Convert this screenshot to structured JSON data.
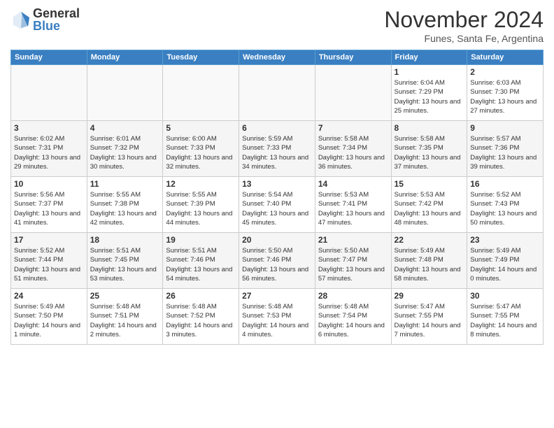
{
  "header": {
    "logo": {
      "general": "General",
      "blue": "Blue"
    },
    "title": "November 2024",
    "location": "Funes, Santa Fe, Argentina"
  },
  "days_of_week": [
    "Sunday",
    "Monday",
    "Tuesday",
    "Wednesday",
    "Thursday",
    "Friday",
    "Saturday"
  ],
  "weeks": [
    [
      {
        "day": "",
        "empty": true
      },
      {
        "day": "",
        "empty": true
      },
      {
        "day": "",
        "empty": true
      },
      {
        "day": "",
        "empty": true
      },
      {
        "day": "",
        "empty": true
      },
      {
        "day": "1",
        "sunrise": "Sunrise: 6:04 AM",
        "sunset": "Sunset: 7:29 PM",
        "daylight": "Daylight: 13 hours and 25 minutes."
      },
      {
        "day": "2",
        "sunrise": "Sunrise: 6:03 AM",
        "sunset": "Sunset: 7:30 PM",
        "daylight": "Daylight: 13 hours and 27 minutes."
      }
    ],
    [
      {
        "day": "3",
        "sunrise": "Sunrise: 6:02 AM",
        "sunset": "Sunset: 7:31 PM",
        "daylight": "Daylight: 13 hours and 29 minutes."
      },
      {
        "day": "4",
        "sunrise": "Sunrise: 6:01 AM",
        "sunset": "Sunset: 7:32 PM",
        "daylight": "Daylight: 13 hours and 30 minutes."
      },
      {
        "day": "5",
        "sunrise": "Sunrise: 6:00 AM",
        "sunset": "Sunset: 7:33 PM",
        "daylight": "Daylight: 13 hours and 32 minutes."
      },
      {
        "day": "6",
        "sunrise": "Sunrise: 5:59 AM",
        "sunset": "Sunset: 7:33 PM",
        "daylight": "Daylight: 13 hours and 34 minutes."
      },
      {
        "day": "7",
        "sunrise": "Sunrise: 5:58 AM",
        "sunset": "Sunset: 7:34 PM",
        "daylight": "Daylight: 13 hours and 36 minutes."
      },
      {
        "day": "8",
        "sunrise": "Sunrise: 5:58 AM",
        "sunset": "Sunset: 7:35 PM",
        "daylight": "Daylight: 13 hours and 37 minutes."
      },
      {
        "day": "9",
        "sunrise": "Sunrise: 5:57 AM",
        "sunset": "Sunset: 7:36 PM",
        "daylight": "Daylight: 13 hours and 39 minutes."
      }
    ],
    [
      {
        "day": "10",
        "sunrise": "Sunrise: 5:56 AM",
        "sunset": "Sunset: 7:37 PM",
        "daylight": "Daylight: 13 hours and 41 minutes."
      },
      {
        "day": "11",
        "sunrise": "Sunrise: 5:55 AM",
        "sunset": "Sunset: 7:38 PM",
        "daylight": "Daylight: 13 hours and 42 minutes."
      },
      {
        "day": "12",
        "sunrise": "Sunrise: 5:55 AM",
        "sunset": "Sunset: 7:39 PM",
        "daylight": "Daylight: 13 hours and 44 minutes."
      },
      {
        "day": "13",
        "sunrise": "Sunrise: 5:54 AM",
        "sunset": "Sunset: 7:40 PM",
        "daylight": "Daylight: 13 hours and 45 minutes."
      },
      {
        "day": "14",
        "sunrise": "Sunrise: 5:53 AM",
        "sunset": "Sunset: 7:41 PM",
        "daylight": "Daylight: 13 hours and 47 minutes."
      },
      {
        "day": "15",
        "sunrise": "Sunrise: 5:53 AM",
        "sunset": "Sunset: 7:42 PM",
        "daylight": "Daylight: 13 hours and 48 minutes."
      },
      {
        "day": "16",
        "sunrise": "Sunrise: 5:52 AM",
        "sunset": "Sunset: 7:43 PM",
        "daylight": "Daylight: 13 hours and 50 minutes."
      }
    ],
    [
      {
        "day": "17",
        "sunrise": "Sunrise: 5:52 AM",
        "sunset": "Sunset: 7:44 PM",
        "daylight": "Daylight: 13 hours and 51 minutes."
      },
      {
        "day": "18",
        "sunrise": "Sunrise: 5:51 AM",
        "sunset": "Sunset: 7:45 PM",
        "daylight": "Daylight: 13 hours and 53 minutes."
      },
      {
        "day": "19",
        "sunrise": "Sunrise: 5:51 AM",
        "sunset": "Sunset: 7:46 PM",
        "daylight": "Daylight: 13 hours and 54 minutes."
      },
      {
        "day": "20",
        "sunrise": "Sunrise: 5:50 AM",
        "sunset": "Sunset: 7:46 PM",
        "daylight": "Daylight: 13 hours and 56 minutes."
      },
      {
        "day": "21",
        "sunrise": "Sunrise: 5:50 AM",
        "sunset": "Sunset: 7:47 PM",
        "daylight": "Daylight: 13 hours and 57 minutes."
      },
      {
        "day": "22",
        "sunrise": "Sunrise: 5:49 AM",
        "sunset": "Sunset: 7:48 PM",
        "daylight": "Daylight: 13 hours and 58 minutes."
      },
      {
        "day": "23",
        "sunrise": "Sunrise: 5:49 AM",
        "sunset": "Sunset: 7:49 PM",
        "daylight": "Daylight: 14 hours and 0 minutes."
      }
    ],
    [
      {
        "day": "24",
        "sunrise": "Sunrise: 5:49 AM",
        "sunset": "Sunset: 7:50 PM",
        "daylight": "Daylight: 14 hours and 1 minute."
      },
      {
        "day": "25",
        "sunrise": "Sunrise: 5:48 AM",
        "sunset": "Sunset: 7:51 PM",
        "daylight": "Daylight: 14 hours and 2 minutes."
      },
      {
        "day": "26",
        "sunrise": "Sunrise: 5:48 AM",
        "sunset": "Sunset: 7:52 PM",
        "daylight": "Daylight: 14 hours and 3 minutes."
      },
      {
        "day": "27",
        "sunrise": "Sunrise: 5:48 AM",
        "sunset": "Sunset: 7:53 PM",
        "daylight": "Daylight: 14 hours and 4 minutes."
      },
      {
        "day": "28",
        "sunrise": "Sunrise: 5:48 AM",
        "sunset": "Sunset: 7:54 PM",
        "daylight": "Daylight: 14 hours and 6 minutes."
      },
      {
        "day": "29",
        "sunrise": "Sunrise: 5:47 AM",
        "sunset": "Sunset: 7:55 PM",
        "daylight": "Daylight: 14 hours and 7 minutes."
      },
      {
        "day": "30",
        "sunrise": "Sunrise: 5:47 AM",
        "sunset": "Sunset: 7:55 PM",
        "daylight": "Daylight: 14 hours and 8 minutes."
      }
    ]
  ]
}
